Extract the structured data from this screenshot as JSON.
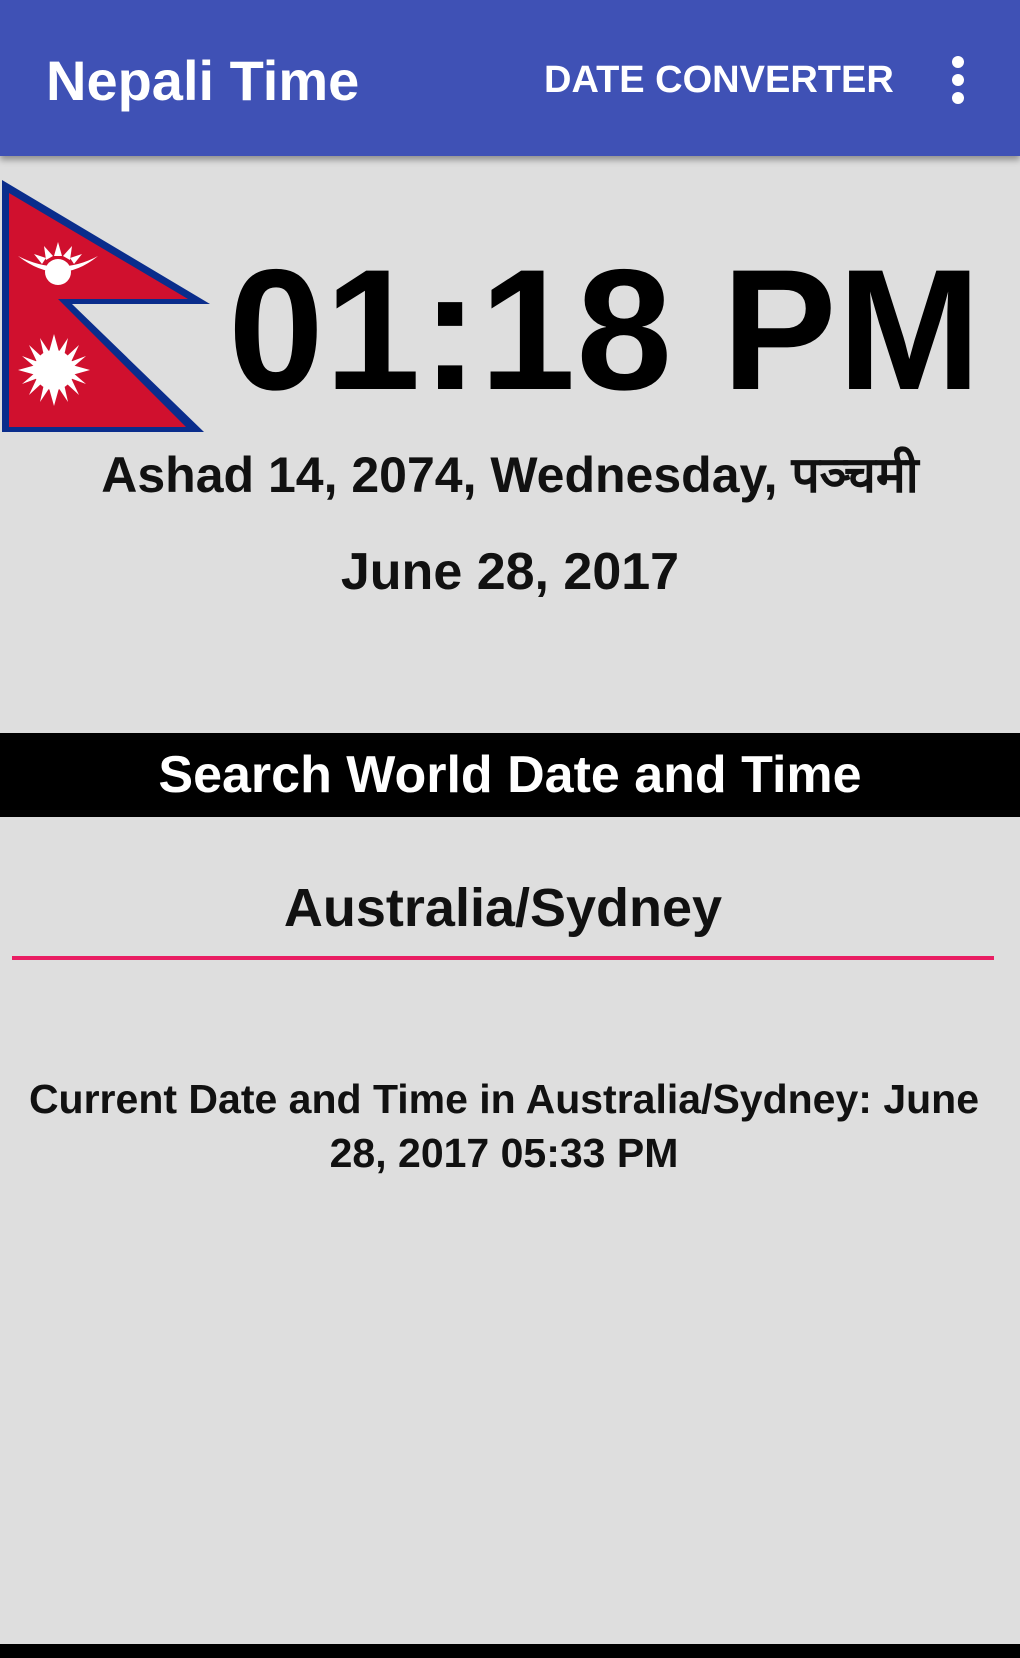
{
  "appbar": {
    "title": "Nepali Time",
    "action_label": "DATE CONVERTER",
    "overflow_icon": "more-vert-icon",
    "color": "#3f51b5"
  },
  "clock": {
    "time": "01:18 PM",
    "nepali_date": "Ashad 14, 2074, Wednesday, पञ्चमी",
    "english_date": "June 28, 2017",
    "flag_icon": "nepal-flag-icon"
  },
  "search": {
    "header": "Search World Date and Time",
    "value": "Australia/Sydney",
    "underline_color": "#e91e63",
    "result": "Current Date and Time in Australia/Sydney: June 28, 2017 05:33 PM"
  }
}
